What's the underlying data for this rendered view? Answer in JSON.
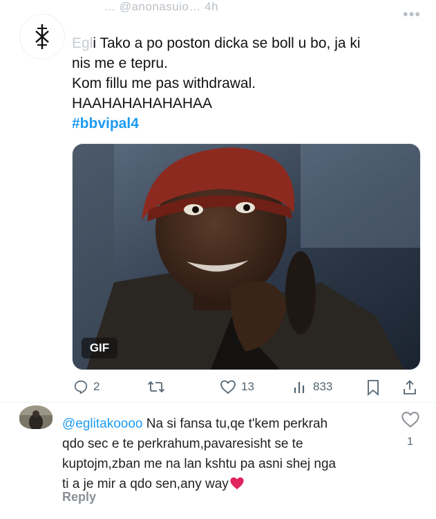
{
  "tweet": {
    "handle_partial": "… @anonasuio… 4h",
    "text_faded_prefix": "Egl",
    "text_line1_rest": "i Tako a po poston dicka se boll u bo, ja ki",
    "text_line2": "nis me e tepru.",
    "text_line3": "Kom fillu me pas withdrawal.",
    "text_line4": "HAAHAHAHAHAHAA",
    "hashtag": "#bbvipal4",
    "gif_badge": "GIF",
    "actions": {
      "reply_count": "2",
      "like_count": "13",
      "views_count": "833"
    }
  },
  "reply": {
    "mention": "@eglitakoooo",
    "line1_rest": " Na si fansa tu,qe t'kem perkrah",
    "line2": "qdo sec e te perkrahum,pavaresisht se te",
    "line3": "kuptojm,zban me na lan kshtu pa asni shej nga",
    "line4": "ti a je mir a qdo sen,any way",
    "like_count": "1",
    "reply_label": "Reply"
  },
  "colors": {
    "accent": "#1d9bf0",
    "muted": "#536471",
    "heart_red": "#e0245e"
  }
}
